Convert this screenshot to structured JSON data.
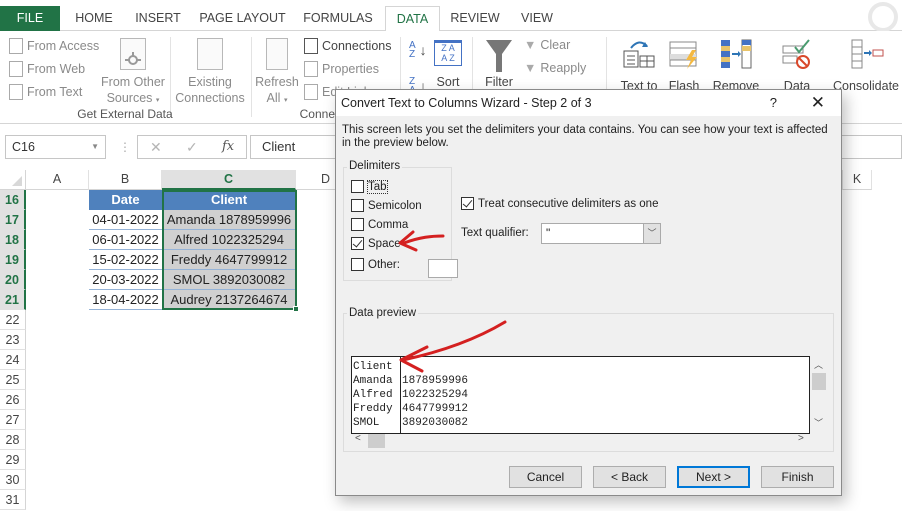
{
  "ribbon_tabs": [
    {
      "label": "FILE"
    },
    {
      "label": "HOME"
    },
    {
      "label": "INSERT"
    },
    {
      "label": "PAGE LAYOUT"
    },
    {
      "label": "FORMULAS"
    },
    {
      "label": "DATA",
      "active": true
    },
    {
      "label": "REVIEW"
    },
    {
      "label": "VIEW"
    }
  ],
  "ribbon": {
    "get_external_data": {
      "from_access": "From Access",
      "from_web": "From Web",
      "from_text": "From Text",
      "from_other_sources_1": "From Other",
      "from_other_sources_2": "Sources",
      "existing_connections_1": "Existing",
      "existing_connections_2": "Connections",
      "group_label": "Get External Data"
    },
    "connections": {
      "refresh_all_1": "Refresh",
      "refresh_all_2": "All",
      "connections": "Connections",
      "properties": "Properties",
      "edit_links": "Edit Links",
      "group_label": "Connect"
    },
    "sort_filter": {
      "sort": "Sort",
      "filter": "Filter",
      "clear": "Clear",
      "reapply": "Reapply"
    },
    "data_tools": {
      "text_to_columns": "Text to",
      "flash_fill": "Flash",
      "remove_duplicates": "Remove",
      "data_validation": "Data",
      "consolidate": "Consolidate"
    }
  },
  "formula_bar": {
    "name_box": "C16",
    "cancel_icon": "✕",
    "enter_icon": "✓",
    "fx_label": "fx",
    "value": "Client"
  },
  "sheet": {
    "columns": [
      "A",
      "B",
      "C",
      "D",
      "K"
    ],
    "selected_column": "C",
    "rows": [
      "16",
      "17",
      "18",
      "19",
      "20",
      "21",
      "22",
      "23",
      "24",
      "25",
      "26",
      "27",
      "28",
      "29",
      "30",
      "31"
    ],
    "table": {
      "headers": {
        "date": "Date",
        "client": "Client"
      },
      "records": [
        {
          "date": "04-01-2022",
          "client": "Amanda 1878959996"
        },
        {
          "date": "06-01-2022",
          "client": "Alfred 1022325294"
        },
        {
          "date": "15-02-2022",
          "client": "Freddy 4647799912"
        },
        {
          "date": "20-03-2022",
          "client": "SMOL 3892030082"
        },
        {
          "date": "18-04-2022",
          "client": "Audrey 2137264674"
        }
      ]
    }
  },
  "dialog": {
    "title": "Convert Text to Columns Wizard - Step 2 of 3",
    "help": "?",
    "close": "✕",
    "description": "This screen lets you set the delimiters your data contains.  You can see how your text is affected in the preview below.",
    "delimiters_label": "Delimiters",
    "delimiters": [
      {
        "label": "Tab",
        "checked": false
      },
      {
        "label": "Semicolon",
        "checked": false
      },
      {
        "label": "Comma",
        "checked": false
      },
      {
        "label": "Space",
        "checked": true
      },
      {
        "label": "Other:",
        "checked": false
      }
    ],
    "other_value": "",
    "treat_consecutive": {
      "label": "Treat consecutive delimiters as one",
      "checked": true
    },
    "text_qualifier": {
      "label": "Text qualifier:",
      "value": "\""
    },
    "data_preview_label": "Data preview",
    "preview_rows": [
      [
        "Client",
        ""
      ],
      [
        "Amanda",
        "1878959996"
      ],
      [
        "Alfred",
        "1022325294"
      ],
      [
        "Freddy",
        "4647799912"
      ],
      [
        "SMOL",
        "3892030082"
      ]
    ],
    "buttons": {
      "cancel": "Cancel",
      "back": "< Back",
      "next": "Next >",
      "finish": "Finish"
    }
  },
  "colors": {
    "excel_green": "#217346",
    "table_header_blue": "#4f81bd",
    "annotation_red": "#d42020",
    "default_button_border": "#0078d7"
  }
}
